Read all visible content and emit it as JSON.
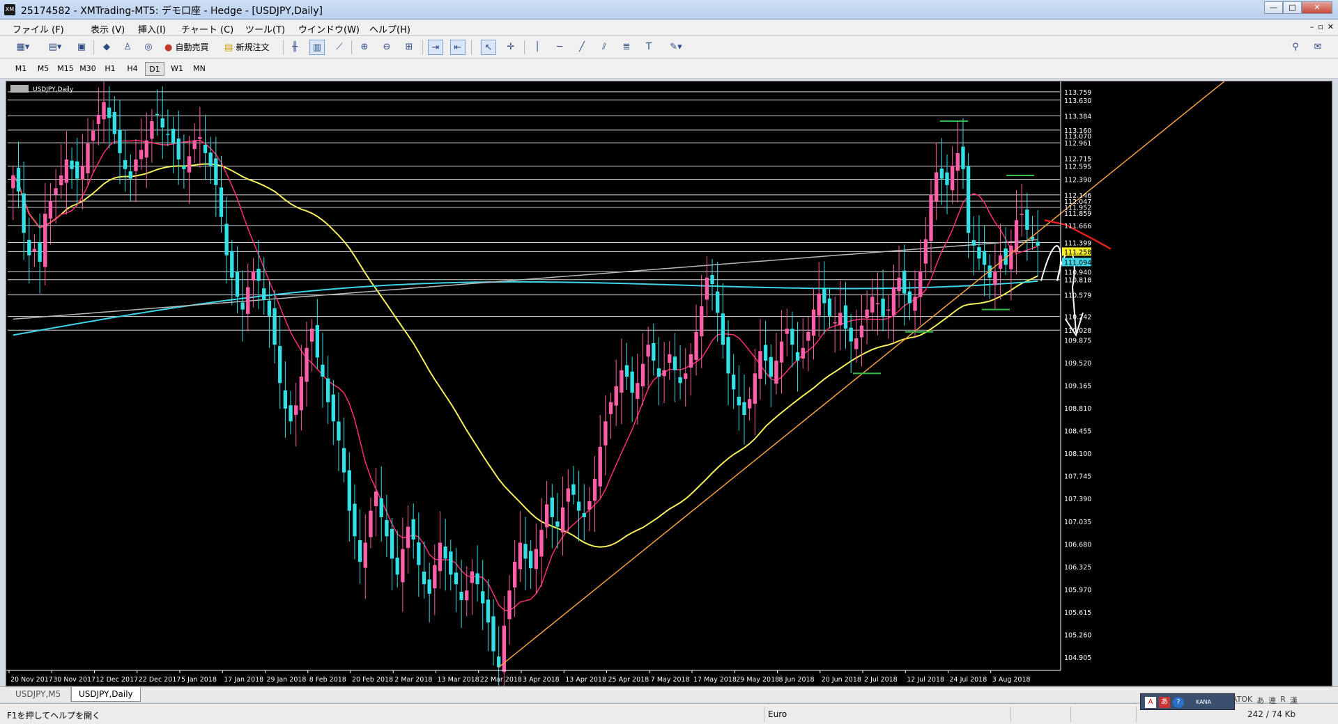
{
  "window": {
    "logo_text": "XM",
    "title": "25174582 - XMTrading-MT5: デモ口座 - Hedge - [USDJPY,Daily]",
    "minimize_symbol": "—",
    "maximize_symbol": "□",
    "close_symbol": "✕"
  },
  "menu": {
    "items": [
      {
        "label": "ファイル (F)"
      },
      {
        "label": "表示 (V)"
      },
      {
        "label": "挿入(I)"
      },
      {
        "label": "チャート (C)"
      },
      {
        "label": "ツール(T)"
      },
      {
        "label": "ウインドウ(W)"
      },
      {
        "label": "ヘルプ(H)"
      }
    ],
    "mdi_buttons": [
      "–",
      "▫",
      "✕"
    ]
  },
  "toolbar": {
    "auto_trade_label": "自動売買",
    "new_order_label": "新規注文",
    "icons": [
      "new-chart-icon",
      "profiles-icon",
      "market-watch-icon",
      "strategy-tester-icon",
      "navigator-icon",
      "signals-icon",
      "auto-trading-icon",
      "new-order-icon",
      "bar-chart-icon",
      "candlestick-icon",
      "line-chart-icon",
      "zoom-in-icon",
      "zoom-out-icon",
      "tile-windows-icon",
      "autoscroll-icon",
      "chart-shift-icon",
      "cursor-icon",
      "crosshair-icon",
      "vertical-line-icon",
      "horizontal-line-icon",
      "trendline-icon",
      "equidistant-channel-icon",
      "fibonacci-icon",
      "text-icon",
      "objects-menu-icon"
    ],
    "right_icons": [
      "search-icon",
      "chat-icon"
    ]
  },
  "timeframes": {
    "items": [
      "M1",
      "M5",
      "M15",
      "M30",
      "H1",
      "H4",
      "D1",
      "W1",
      "MN"
    ],
    "active": "D1"
  },
  "chart": {
    "label": "USDJPY,Daily",
    "colors": {
      "background": "#000000",
      "bull_candle": "#ff5fa8",
      "bear_candle": "#33e0e6",
      "ma_fast": "#ff2f6e",
      "ma_mid": "#f4ef5a",
      "ma_slow_cyan": "#3fd4e6",
      "ma_slow_gray": "#b8b8b8",
      "trendline": "#f5a040",
      "sr_lines": "#ffffff",
      "bid_marker": "#f4ef2a",
      "ask_marker": "#3fd4e6"
    }
  },
  "chart_data": {
    "type": "candlestick",
    "symbol": "USDJPY",
    "timeframe": "Daily",
    "ylim": [
      104.7,
      113.9
    ],
    "price_ticks": [
      "113.759",
      "113.630",
      "113.384",
      "113.160",
      "113.070",
      "112.961",
      "112.715",
      "112.595",
      "112.390",
      "112.146",
      "112.047",
      "111.952",
      "111.859",
      "111.666",
      "111.399",
      "111.258",
      "111.094",
      "110.940",
      "110.818",
      "110.579",
      "110.242",
      "110.028",
      "109.875",
      "109.520",
      "109.165",
      "108.810",
      "108.455",
      "108.100",
      "107.745",
      "107.390",
      "107.035",
      "106.680",
      "106.325",
      "105.970",
      "105.615",
      "105.260",
      "104.905"
    ],
    "current_bid": "111.258",
    "current_ask": "111.094",
    "sr_levels": [
      113.759,
      113.63,
      113.384,
      113.16,
      112.961,
      112.595,
      112.39,
      112.146,
      112.047,
      111.952,
      111.666,
      111.399,
      111.258,
      110.94,
      110.818,
      110.579,
      110.242,
      110.028
    ],
    "date_labels": [
      "20 Nov 2017",
      "30 Nov 2017",
      "12 Dec 2017",
      "22 Dec 2017",
      "5 Jan 2018",
      "17 Jan 2018",
      "29 Jan 2018",
      "8 Feb 2018",
      "20 Feb 2018",
      "2 Mar 2018",
      "13 Mar 2018",
      "22 Mar 2018",
      "3 Apr 2018",
      "13 Apr 2018",
      "25 Apr 2018",
      "7 May 2018",
      "17 May 2018",
      "29 May 2018",
      "8 Jun 2018",
      "20 Jun 2018",
      "2 Jul 2018",
      "12 Jul 2018",
      "24 Jul 2018",
      "3 Aug 2018"
    ],
    "closes": [
      112.45,
      112.2,
      111.55,
      111.2,
      111.3,
      111.1,
      111.85,
      112.05,
      112.25,
      112.45,
      112.7,
      112.55,
      112.4,
      112.6,
      112.95,
      113.15,
      113.4,
      113.6,
      113.35,
      113.1,
      112.8,
      112.55,
      112.4,
      112.7,
      112.85,
      113.0,
      113.3,
      113.4,
      113.2,
      113.1,
      112.95,
      112.7,
      112.55,
      112.75,
      113.0,
      113.05,
      112.8,
      112.6,
      112.3,
      111.8,
      111.2,
      110.85,
      110.55,
      110.35,
      110.7,
      110.95,
      110.8,
      110.5,
      110.25,
      109.8,
      109.2,
      108.8,
      108.6,
      108.85,
      109.3,
      109.75,
      110.05,
      109.6,
      109.3,
      108.9,
      108.6,
      108.3,
      107.8,
      107.2,
      106.8,
      106.4,
      106.7,
      107.2,
      107.5,
      107.1,
      106.8,
      106.45,
      106.2,
      106.6,
      106.95,
      106.75,
      106.35,
      106.05,
      105.9,
      106.35,
      106.7,
      106.45,
      106.2,
      106.05,
      105.8,
      105.95,
      106.25,
      106.05,
      105.75,
      105.45,
      105.0,
      104.75,
      105.4,
      105.95,
      106.4,
      106.7,
      106.45,
      106.3,
      106.6,
      106.9,
      107.3,
      107.1,
      106.95,
      107.25,
      107.55,
      107.45,
      107.2,
      107.1,
      107.35,
      107.7,
      108.2,
      108.6,
      108.9,
      109.15,
      109.4,
      109.3,
      109.05,
      109.2,
      109.5,
      109.8,
      109.55,
      109.3,
      109.4,
      109.65,
      109.4,
      109.2,
      109.35,
      109.65,
      110.0,
      110.4,
      110.85,
      110.75,
      110.3,
      109.8,
      109.35,
      109.1,
      108.85,
      108.7,
      108.95,
      109.35,
      109.7,
      109.55,
      109.3,
      109.55,
      109.85,
      110.05,
      109.8,
      109.55,
      109.75,
      110.0,
      110.35,
      110.6,
      110.45,
      110.25,
      110.15,
      110.3,
      110.05,
      109.85,
      109.9,
      110.1,
      110.35,
      110.55,
      110.45,
      110.25,
      110.35,
      110.7,
      110.85,
      110.6,
      110.45,
      110.55,
      110.95,
      111.45,
      112.15,
      112.5,
      112.4,
      112.3,
      112.6,
      112.8,
      112.55,
      111.55,
      111.35,
      111.15,
      111.05,
      110.85,
      110.95,
      111.2,
      111.05,
      111.35,
      111.75,
      111.85,
      111.6,
      111.45,
      111.35
    ]
  },
  "annotations": {
    "arrow_hint": "white hand-drawn arrow projecting decline"
  },
  "bottom_tabs": {
    "items": [
      "USDJPY,M5",
      "USDJPY,Daily"
    ],
    "active": "USDJPY,Daily"
  },
  "status": {
    "help_text": "F1を押してヘルプを開く",
    "profile": "Euro",
    "traffic": "242 / 74 Kb"
  },
  "ime": {
    "atok_label": "ATOK",
    "mode_chars": [
      "あ",
      "連",
      "R",
      "漢"
    ]
  }
}
